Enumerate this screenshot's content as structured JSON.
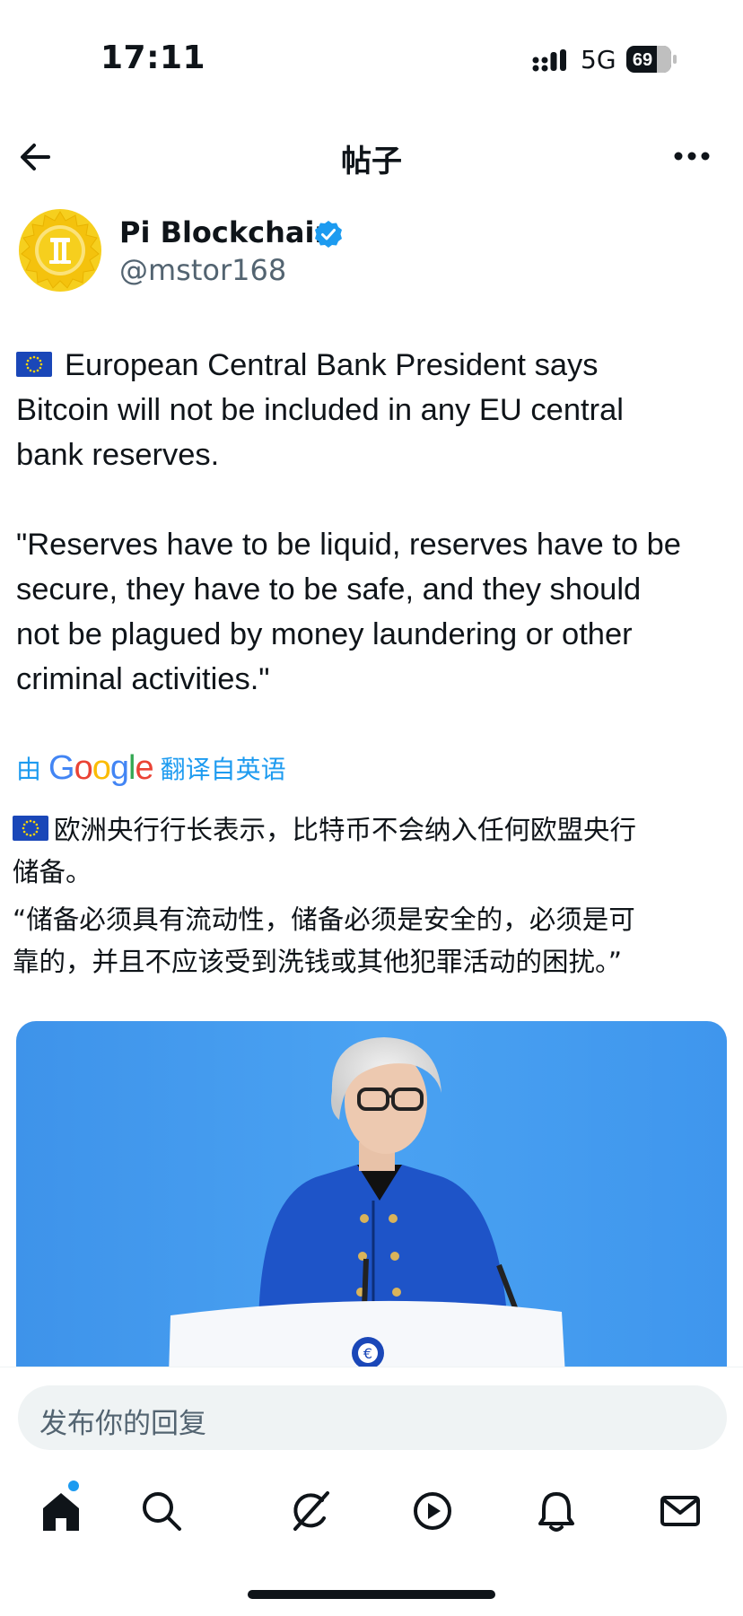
{
  "status_bar": {
    "time": "17:11",
    "network": "5G",
    "battery": "69"
  },
  "nav": {
    "title": "帖子"
  },
  "author": {
    "name": "Pi Blockchain",
    "handle": "@mstor168"
  },
  "post": {
    "line1": "European Central Bank President says",
    "line2": "Bitcoin will not be included in any EU central",
    "line3": "bank reserves.",
    "quote1": "\"Reserves have to be liquid, reserves have to be",
    "quote2": "secure, they have to be safe, and they should",
    "quote3": "not be plagued by money laundering or other",
    "quote4": "criminal activities.\""
  },
  "translation": {
    "prefix": "由",
    "google": "Google",
    "suffix": "翻译自英语",
    "para1_line1": "欧洲央行行长表示，比特币不会纳入任何欧盟央行",
    "para1_line2": "储备。",
    "para2_line1": "“储备必须具有流动性，储备必须是安全的，必须是可",
    "para2_line2": "靠的，并且不应该受到洗钱或其他犯罪活动的困扰。”"
  },
  "reply": {
    "placeholder": "发布你的回复"
  },
  "tabs": [
    {
      "name": "home",
      "icon": "home-icon",
      "active": true
    },
    {
      "name": "search",
      "icon": "search-icon"
    },
    {
      "name": "grok",
      "icon": "grok-icon"
    },
    {
      "name": "video",
      "icon": "play-icon"
    },
    {
      "name": "notifications",
      "icon": "bell-icon"
    },
    {
      "name": "messages",
      "icon": "mail-icon"
    }
  ],
  "colors": {
    "accent": "#1d9bf0",
    "text": "#0f1419",
    "secondary": "#536471",
    "media_bg": "#3d97ee",
    "avatar_gold": "#f4c20d"
  }
}
